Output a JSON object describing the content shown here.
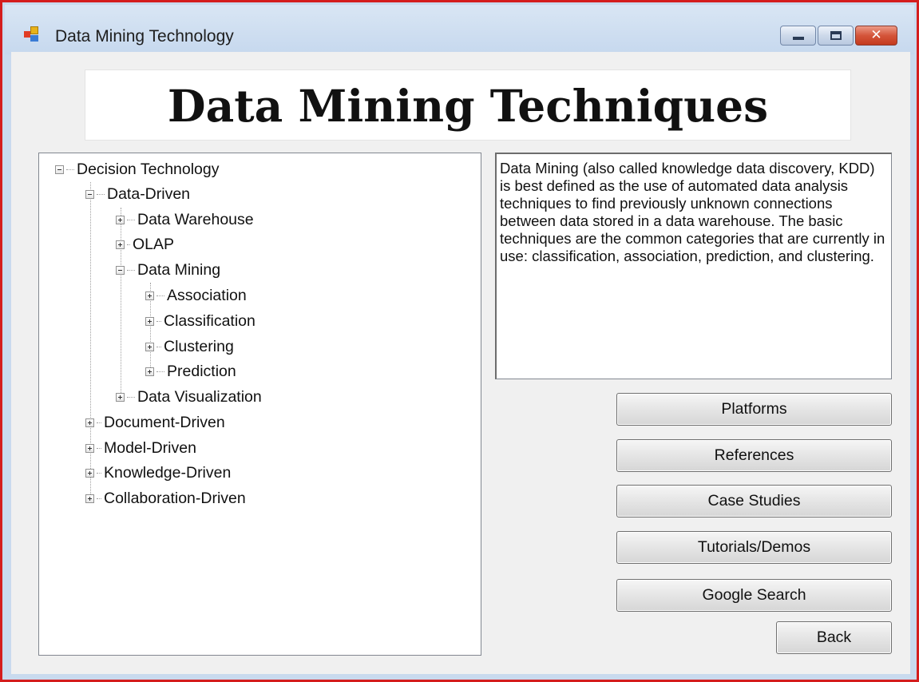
{
  "window": {
    "title": "Data Mining Technology",
    "controls": {
      "minimize": "minimize",
      "maximize": "maximize",
      "close": "✕"
    }
  },
  "banner": {
    "title": "Data Mining Techniques"
  },
  "tree": {
    "root": "Decision Technology",
    "data_driven": "Data-Driven",
    "data_warehouse": "Data Warehouse",
    "olap": "OLAP",
    "data_mining": "Data Mining",
    "association": "Association",
    "classification": "Classification",
    "clustering": "Clustering",
    "prediction": "Prediction",
    "data_visualization": "Data Visualization",
    "document_driven": "Document-Driven",
    "model_driven": "Model-Driven",
    "knowledge_driven": "Knowledge-Driven",
    "collaboration_driven": "Collaboration-Driven"
  },
  "description": {
    "text": "Data Mining (also called knowledge data discovery, KDD) is best defined as the use of automated data analysis techniques to find previously unknown connections between data stored in a data warehouse. The basic techniques are the common categories that are currently in use: classification, association, prediction, and clustering."
  },
  "buttons": {
    "platforms": "Platforms",
    "references": "References",
    "case_studies": "Case Studies",
    "tutorials": "Tutorials/Demos",
    "google_search": "Google Search",
    "back": "Back"
  },
  "colors": {
    "window_border": "#d41d1d",
    "titlebar": "#c9daee",
    "client_bg": "#f0f0f0",
    "close_button": "#c43a1e"
  }
}
